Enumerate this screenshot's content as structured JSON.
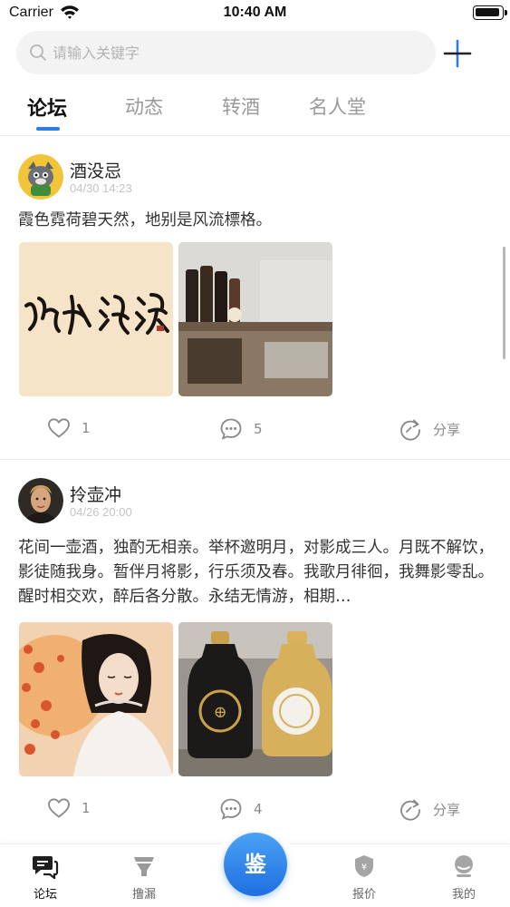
{
  "status_bar": {
    "carrier": "Carrier",
    "time": "10:40 AM"
  },
  "search": {
    "placeholder": "请输入关键字",
    "value": ""
  },
  "tabs": [
    {
      "label": "论坛",
      "active": true
    },
    {
      "label": "动态",
      "active": false
    },
    {
      "label": "转酒",
      "active": false
    },
    {
      "label": "名人堂",
      "active": false
    }
  ],
  "posts": [
    {
      "author": "酒没忌",
      "time": "04/30 14:23",
      "text": "霞色霓荷碧天然，地别是风流標格。",
      "images": [
        "calligraphy-image",
        "liquor-bottles-image"
      ],
      "likes": "1",
      "comments": "5",
      "share_label": "分享"
    },
    {
      "author": "拎壶冲",
      "time": "04/26 20:00",
      "text": "花间一壶酒，独酌无相亲。举杯邀明月，对影成三人。月既不解饮，影徒随我身。暂伴月将影，行乐须及春。我歌月徘徊，我舞影零乱。醒时相交欢，醉后各分散。永结无情游，相期…",
      "images": [
        "woman-portrait-image",
        "liquor-jars-image"
      ],
      "likes": "1",
      "comments": "4",
      "share_label": "分享"
    }
  ],
  "tab_bar": {
    "items": [
      {
        "label": "论坛",
        "icon": "forum-icon",
        "active": true
      },
      {
        "label": "撸漏",
        "icon": "funnel-icon",
        "active": false
      },
      {
        "label": "鉴",
        "icon": "appraise-button",
        "active": false
      },
      {
        "label": "报价",
        "icon": "price-shield-icon",
        "active": false
      },
      {
        "label": "我的",
        "icon": "profile-icon",
        "active": false
      }
    ]
  },
  "colors": {
    "accent": "#2f7be9",
    "center_button": "#2b83ea",
    "divider": "#ececec"
  }
}
